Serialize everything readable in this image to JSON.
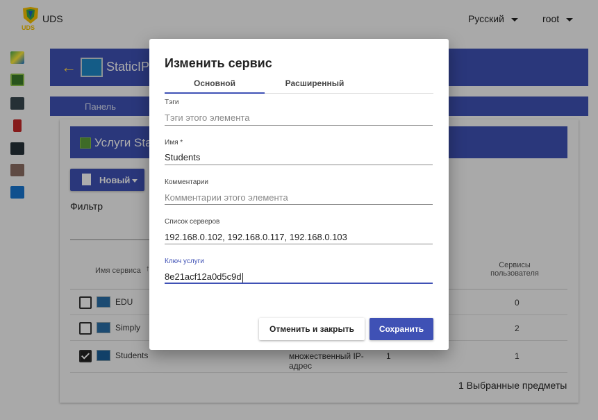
{
  "app": {
    "logo_text": "UDS",
    "language": "Русский",
    "user": "root"
  },
  "page": {
    "title": "StaticIP",
    "tab": "Панель"
  },
  "card": {
    "title": "Услуги Sta",
    "new_button": "Новый",
    "filter_label": "Фильтр",
    "columns": {
      "service_name": "Имя сервиса",
      "user_services": "Сервисы пользователя"
    },
    "rows": [
      {
        "name": "EDU",
        "user_services": "0",
        "checked": false
      },
      {
        "name": "Simply",
        "user_services": "2",
        "checked": false
      },
      {
        "name": "Students",
        "type": "множественный IP-адрес",
        "col3": "1",
        "user_services": "1",
        "checked": true
      }
    ],
    "selected_info": "1 Выбранные предметы"
  },
  "dialog": {
    "title": "Изменить сервис",
    "tabs": [
      "Основной",
      "Расширенный"
    ],
    "fields": {
      "tags": {
        "label": "Тэги",
        "placeholder": "Тэги этого элемента"
      },
      "name": {
        "label": "Имя *",
        "value": "Students"
      },
      "comments": {
        "label": "Комментарии",
        "placeholder": "Комментарии этого элемента"
      },
      "servers": {
        "label": "Список серверов",
        "value": "192.168.0.102, 192.168.0.117, 192.168.0.103"
      },
      "service_key": {
        "label": "Ключ услуги",
        "value": "8e21acf12a0d5c9d"
      }
    },
    "cancel_button": "Отменить и закрыть",
    "save_button": "Сохранить"
  },
  "colors": {
    "primary": "#3f51b5",
    "accent_yellow": "#ffd54f"
  }
}
